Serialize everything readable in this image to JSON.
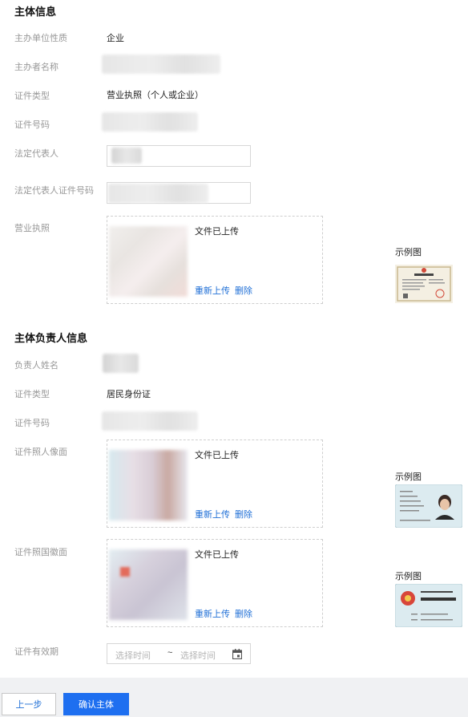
{
  "subject_info": {
    "title": "主体信息",
    "org_type_label": "主办单位性质",
    "org_type_value": "企业",
    "org_name_label": "主办者名称",
    "cert_type_label": "证件类型",
    "cert_type_value": "营业执照（个人或企业）",
    "cert_no_label": "证件号码",
    "legal_rep_label": "法定代表人",
    "legal_rep_id_label": "法定代表人证件号码",
    "license_label": "营业执照",
    "license_upload": {
      "status": "文件已上传",
      "reupload": "重新上传",
      "delete": "删除"
    },
    "example_label": "示例图"
  },
  "principal_info": {
    "title": "主体负责人信息",
    "name_label": "负责人姓名",
    "cert_type_label": "证件类型",
    "cert_type_value": "居民身份证",
    "cert_no_label": "证件号码",
    "portrait_label": "证件照人像面",
    "portrait_upload": {
      "status": "文件已上传",
      "reupload": "重新上传",
      "delete": "删除"
    },
    "portrait_example_label": "示例图",
    "emblem_label": "证件照国徽面",
    "emblem_upload": {
      "status": "文件已上传",
      "reupload": "重新上传",
      "delete": "删除"
    },
    "emblem_example_label": "示例图",
    "validity_label": "证件有效期",
    "date_start_placeholder": "选择时间",
    "date_separator": "~",
    "date_end_placeholder": "选择时间"
  },
  "footer": {
    "prev_label": "上一步",
    "confirm_label": "确认主体"
  },
  "colors": {
    "link": "#1f6fd6",
    "primary": "#1e6ff0",
    "footer_bg": "#f0f1f3"
  },
  "icons": {
    "calendar": "calendar-icon"
  }
}
